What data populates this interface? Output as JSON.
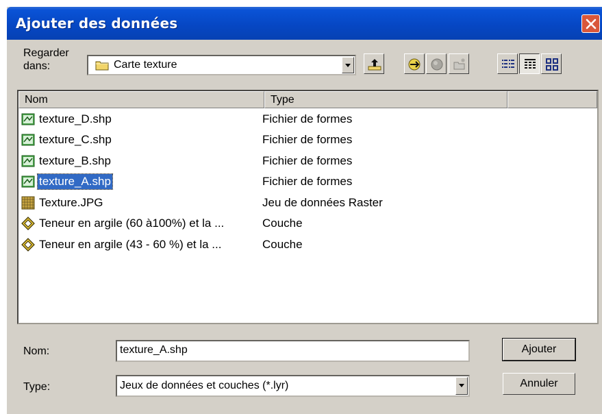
{
  "dialog": {
    "title": "Ajouter des données",
    "close_icon": "close-icon"
  },
  "look_in": {
    "label_line1": "Regarder",
    "label_line2": "dans:",
    "value": "Carte texture",
    "icon": "folder-icon"
  },
  "toolbar": {
    "buttons": [
      {
        "name": "up-one-level-button",
        "icon": "folder-up-arrow-icon"
      },
      {
        "name": "connect-folder-button",
        "icon": "connect-folder-icon"
      },
      {
        "name": "disconnect-folder-button",
        "icon": "disconnect-folder-icon"
      },
      {
        "name": "new-folder-button",
        "icon": "new-folder-icon"
      },
      {
        "name": "list-view-button",
        "icon": "list-view-icon"
      },
      {
        "name": "details-view-button",
        "icon": "details-view-icon"
      },
      {
        "name": "thumbnails-view-button",
        "icon": "thumbnails-view-icon"
      }
    ]
  },
  "file_list": {
    "columns": [
      "Nom",
      "Type"
    ],
    "rows": [
      {
        "name": "texture_D.shp",
        "type": "Fichier de formes",
        "icon": "shapefile-icon",
        "selected": false
      },
      {
        "name": "texture_C.shp",
        "type": "Fichier de formes",
        "icon": "shapefile-icon",
        "selected": false
      },
      {
        "name": "texture_B.shp",
        "type": "Fichier de formes",
        "icon": "shapefile-icon",
        "selected": false
      },
      {
        "name": "texture_A.shp",
        "type": "Fichier de formes",
        "icon": "shapefile-icon",
        "selected": true
      },
      {
        "name": "Texture.JPG",
        "type": "Jeu de données Raster",
        "icon": "raster-icon",
        "selected": false
      },
      {
        "name": "Teneur en argile (60 à100%) et la ...",
        "type": "Couche",
        "icon": "layer-icon",
        "selected": false
      },
      {
        "name": "Teneur en argile (43 - 60 %) et la ...",
        "type": "Couche",
        "icon": "layer-icon",
        "selected": false
      }
    ]
  },
  "name_field": {
    "label": "Nom:",
    "value": "texture_A.shp"
  },
  "type_field": {
    "label": "Type:",
    "value": "Jeux de données et couches (*.lyr)"
  },
  "buttons": {
    "add": "Ajouter",
    "cancel": "Annuler"
  },
  "colors": {
    "title_bar": "#0647c4",
    "selection": "#316ac5",
    "dialog_bg": "#d4d0c8",
    "close_button": "#d9573a"
  }
}
